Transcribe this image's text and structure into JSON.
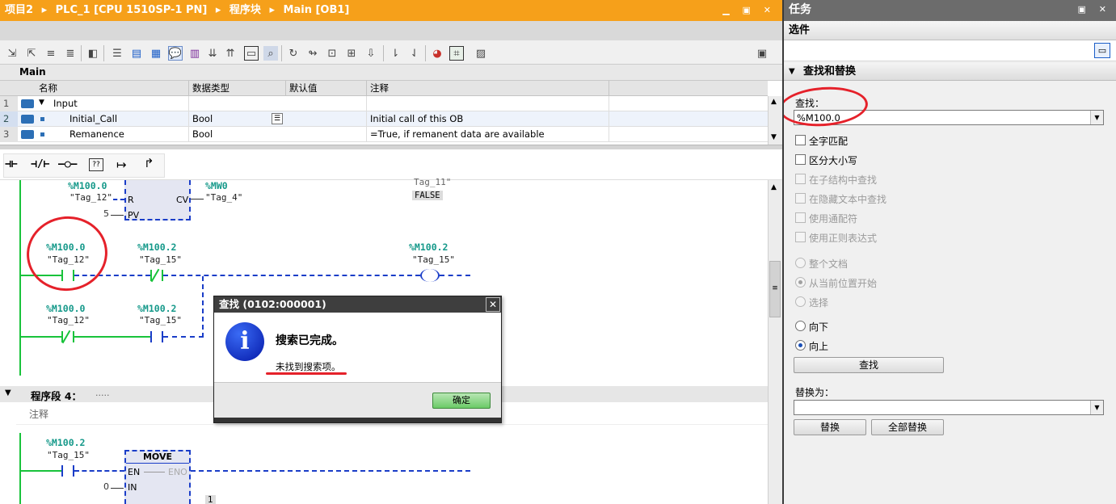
{
  "breadcrumb": {
    "project": "项目2",
    "plc": "PLC_1 [CPU 1510SP-1 PN]",
    "folder": "程序块",
    "block": "Main [OB1]",
    "sep": "▸"
  },
  "window_controls": {
    "minimize": "▁",
    "restore": "▣",
    "close": "✕"
  },
  "block_name": "Main",
  "interface_table": {
    "headers": [
      "名称",
      "数据类型",
      "默认值",
      "注释"
    ],
    "rows": [
      {
        "num": "1",
        "name": "Input",
        "type": "",
        "default": "",
        "comment": ""
      },
      {
        "num": "2",
        "name": "Initial_Call",
        "type": "Bool",
        "default": "",
        "comment": "Initial call of this OB"
      },
      {
        "num": "3",
        "name": "Remanence",
        "type": "Bool",
        "default": "",
        "comment": "=True, if remanent data are available"
      }
    ]
  },
  "ladder": {
    "top_block": {
      "reset_addr": "%M100.0",
      "reset_tag": "\"Tag_12\"",
      "r": "R",
      "pv_val": "5",
      "pv": "PV",
      "cv": "CV",
      "cv_addr": "%MW0",
      "cv_tag": "\"Tag_4\"",
      "false_label": "FALSE",
      "tag_partial": "Tag_11\""
    },
    "rung1": {
      "c1_addr": "%M100.0",
      "c1_tag": "\"Tag_12\"",
      "c2_addr": "%M100.2",
      "c2_tag": "\"Tag_15\"",
      "coil_addr": "%M100.2",
      "coil_tag": "\"Tag_15\""
    },
    "rung2": {
      "c1_addr": "%M100.0",
      "c1_tag": "\"Tag_12\"",
      "c2_addr": "%M100.2",
      "c2_tag": "\"Tag_15\""
    },
    "network4": {
      "label": "程序段 4：",
      "dots": ".....",
      "comment": "注释"
    },
    "rung3": {
      "c1_addr": "%M100.2",
      "c1_tag": "\"Tag_15\"",
      "move": "MOVE",
      "en": "EN",
      "eno": "ENO",
      "in": "IN",
      "in_val": "0",
      "out_partial": "1"
    }
  },
  "dialog": {
    "title": "查找 (0102:000001)",
    "close": "✕",
    "message": "搜索已完成。",
    "detail": "未找到搜索项。",
    "ok": "确定"
  },
  "right_panel": {
    "title": "任务",
    "options": "选件",
    "section": "查找和替换",
    "find_label": "查找：",
    "find_value": "%M100.0",
    "checkboxes": [
      {
        "label": "全字匹配",
        "enabled": true
      },
      {
        "label": "区分大小写",
        "enabled": true
      },
      {
        "label": "在子结构中查找",
        "enabled": false
      },
      {
        "label": "在隐藏文本中查找",
        "enabled": false
      },
      {
        "label": "使用通配符",
        "enabled": false
      },
      {
        "label": "使用正则表达式",
        "enabled": false
      }
    ],
    "scope": [
      {
        "label": "整个文档",
        "enabled": false,
        "selected": false
      },
      {
        "label": "从当前位置开始",
        "enabled": false,
        "selected": true
      },
      {
        "label": "选择",
        "enabled": false,
        "selected": false
      }
    ],
    "direction": [
      {
        "label": "向下",
        "selected": false
      },
      {
        "label": "向上",
        "selected": true
      }
    ],
    "find_button": "查找",
    "replace_label": "替换为：",
    "replace_value": "",
    "replace_button": "替换",
    "replace_all_button": "全部替换"
  },
  "colors": {
    "accent": "#f6a01a",
    "green": "#19c33b",
    "blue": "#1a3dc8",
    "teal": "#16998a",
    "red_annotation": "#e5212a"
  }
}
